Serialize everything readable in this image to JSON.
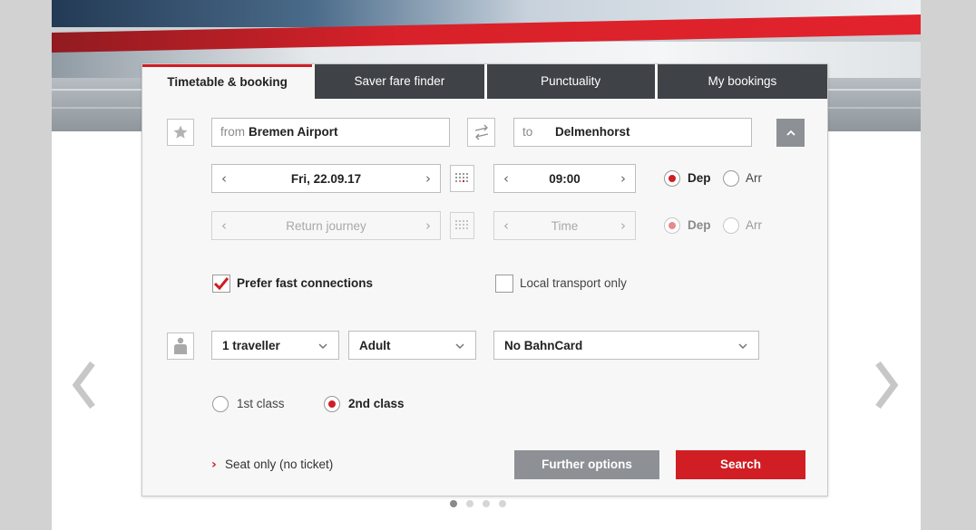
{
  "tabs": [
    {
      "label": "Timetable & booking"
    },
    {
      "label": "Saver fare finder"
    },
    {
      "label": "Punctuality"
    },
    {
      "label": "My bookings"
    }
  ],
  "route": {
    "from_prefix": "from",
    "from_value": "Bremen Airport",
    "to_prefix": "to",
    "to_value": "Delmenhorst"
  },
  "outbound": {
    "date": "Fri, 22.09.17",
    "time": "09:00",
    "dep_label": "Dep",
    "arr_label": "Arr",
    "selected": "Dep"
  },
  "return": {
    "date_placeholder": "Return journey",
    "time_placeholder": "Time",
    "dep_label": "Dep",
    "arr_label": "Arr",
    "selected": "Dep"
  },
  "options": {
    "prefer_fast": {
      "label": "Prefer fast connections",
      "checked": true
    },
    "local_only": {
      "label": "Local transport only",
      "checked": false
    }
  },
  "travellers": {
    "count": "1 traveller",
    "type": "Adult",
    "bahncard": "No BahnCard"
  },
  "travel_class": {
    "first": "1st class",
    "second": "2nd class",
    "selected": "2nd class"
  },
  "links": {
    "seat_only": "Seat only (no ticket)"
  },
  "buttons": {
    "further_options": "Further options",
    "search": "Search"
  },
  "carousel": {
    "pages": 4,
    "active": 1
  },
  "colors": {
    "accent": "#d01e24",
    "tab_dark": "#3f4246",
    "secondary_button": "#8d9196"
  }
}
